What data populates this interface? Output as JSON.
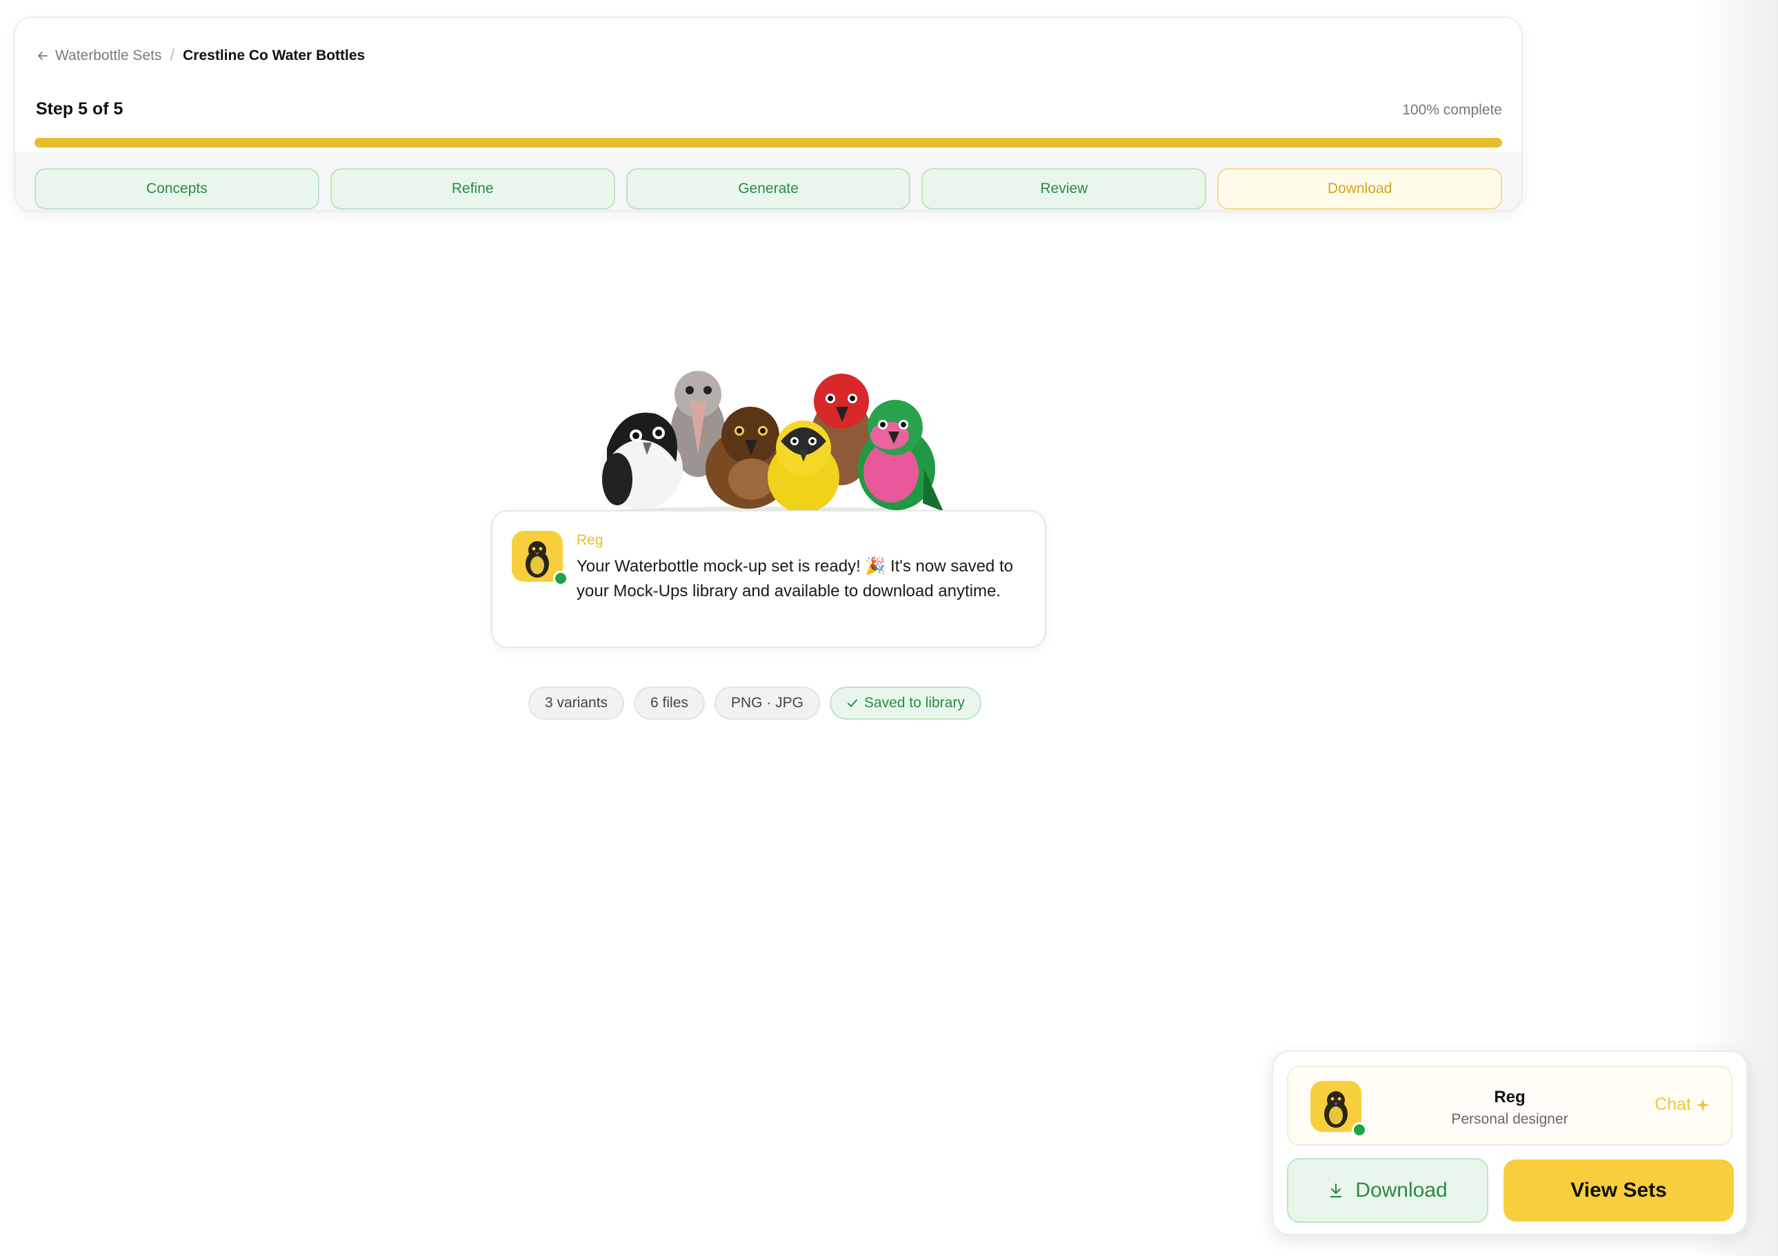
{
  "breadcrumb": {
    "back_label": "Waterbottle Sets",
    "separator": "/",
    "current": "Crestline Co Water Bottles"
  },
  "progress": {
    "step_label": "Step 5 of 5",
    "percent_label": "100% complete",
    "percent": 100
  },
  "steps": [
    {
      "label": "Concepts",
      "state": "done"
    },
    {
      "label": "Refine",
      "state": "done"
    },
    {
      "label": "Generate",
      "state": "done"
    },
    {
      "label": "Review",
      "state": "done"
    },
    {
      "label": "Download",
      "state": "current"
    }
  ],
  "message": {
    "sender": "Reg",
    "text": "Your Waterbottle mock-up set is ready! 🎉 It's now saved to your Mock-Ups library and available to download anytime."
  },
  "chips": [
    {
      "label": "3 variants"
    },
    {
      "label": "6 files"
    },
    {
      "label": "PNG · JPG"
    },
    {
      "label": "Saved to library",
      "icon": "check-icon"
    }
  ],
  "assistant": {
    "name": "Reg",
    "role": "Personal designer",
    "chat_label": "Chat",
    "chat_icon": "sparkle-icon",
    "download_label": "Download",
    "download_icon": "download-icon",
    "view_label": "View Sets"
  },
  "colors": {
    "accent_yellow": "#f7cf3d",
    "progress_yellow": "#e8bd2e",
    "success_green": "#2b8a45",
    "success_bg": "#e9f6ec",
    "online_green": "#1fa34a"
  }
}
